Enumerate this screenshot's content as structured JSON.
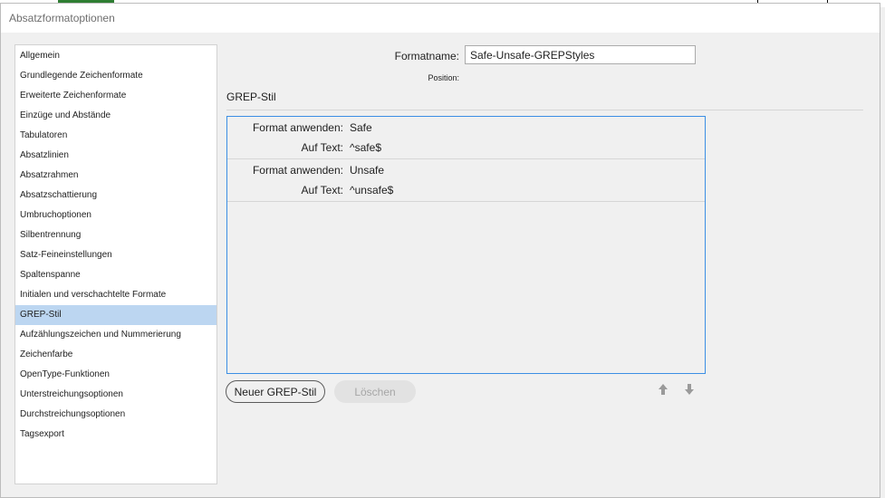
{
  "dialog": {
    "title": "Absatzformatoptionen"
  },
  "sidebar": {
    "items": [
      {
        "label": "Allgemein"
      },
      {
        "label": "Grundlegende Zeichenformate"
      },
      {
        "label": "Erweiterte Zeichenformate"
      },
      {
        "label": "Einzüge und Abstände"
      },
      {
        "label": "Tabulatoren"
      },
      {
        "label": "Absatzlinien"
      },
      {
        "label": "Absatzrahmen"
      },
      {
        "label": "Absatzschattierung"
      },
      {
        "label": "Umbruchoptionen"
      },
      {
        "label": "Silbentrennung"
      },
      {
        "label": "Satz-Feineinstellungen"
      },
      {
        "label": "Spaltenspanne"
      },
      {
        "label": "Initialen und verschachtelte Formate"
      },
      {
        "label": "GREP-Stil",
        "selected": true
      },
      {
        "label": "Aufzählungszeichen und Nummerierung"
      },
      {
        "label": "Zeichenfarbe"
      },
      {
        "label": "OpenType-Funktionen"
      },
      {
        "label": "Unterstreichungsoptionen"
      },
      {
        "label": "Durchstreichungsoptionen"
      },
      {
        "label": "Tagsexport"
      }
    ]
  },
  "format": {
    "name_label": "Formatname:",
    "name_value": "Safe-Unsafe-GREPStyles",
    "position_label": "Position:"
  },
  "section": {
    "heading": "GREP-Stil"
  },
  "grep_styles": [
    {
      "apply_label": "Format anwenden:",
      "apply_value": "Safe",
      "text_label": "Auf Text:",
      "text_value": "^safe$"
    },
    {
      "apply_label": "Format anwenden:",
      "apply_value": "Unsafe",
      "text_label": "Auf Text:",
      "text_value": "^unsafe$"
    }
  ],
  "buttons": {
    "new_label": "Neuer GREP-Stil",
    "delete_label": "Löschen",
    "delete_enabled": false
  },
  "icons": {
    "move_up": "arrow-up-icon",
    "move_down": "arrow-down-icon"
  },
  "colors": {
    "selection": "#bcd6f1",
    "list_border": "#3b8ee4",
    "background": "#f0f0f0"
  }
}
